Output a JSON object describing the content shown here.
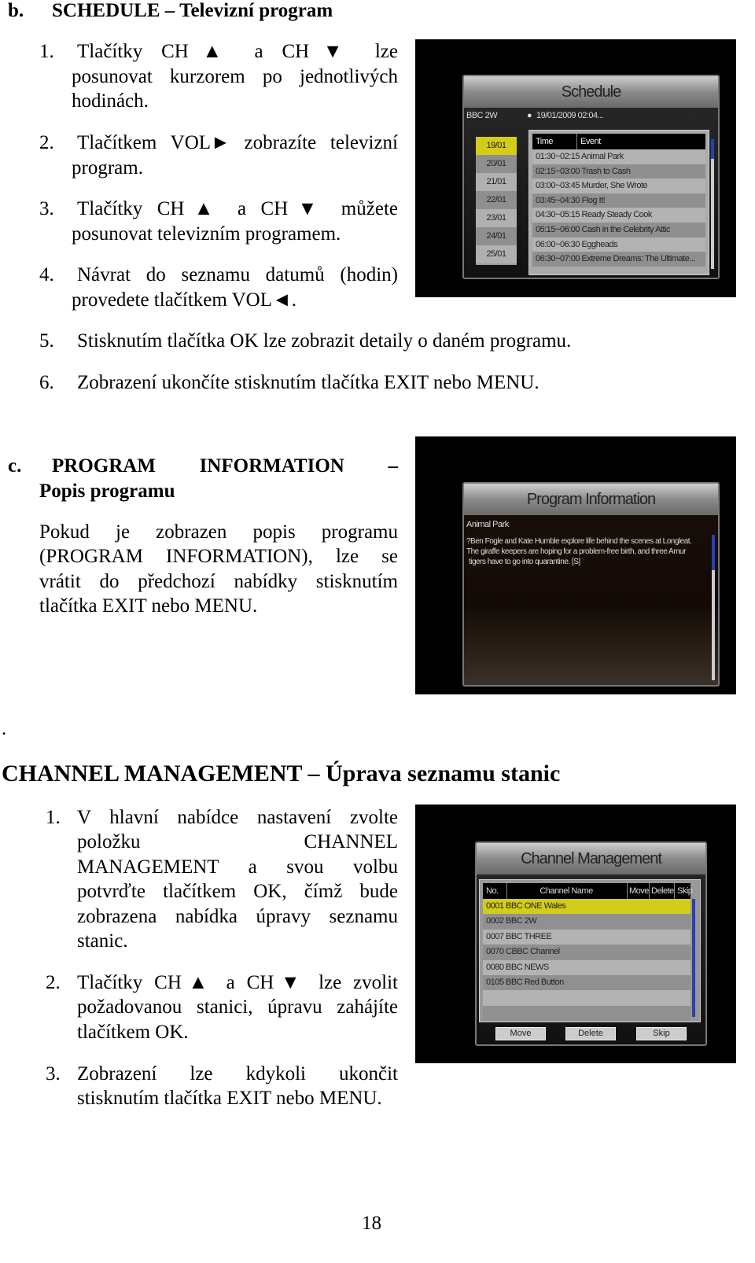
{
  "section_b": {
    "letter": "b.",
    "title": "SCHEDULE – Televizní program",
    "items": [
      {
        "num": "1.",
        "text_first": "Tlačítky CH▲ a CH▼ lze",
        "text_rest": [
          "posunovat kurzorem po jednotlivých",
          "hodinách."
        ]
      },
      {
        "num": "2.",
        "text_first": "Tlačítkem VOL► zobrazíte televizní",
        "text_rest": [
          "program."
        ]
      },
      {
        "num": "3.",
        "text_first": "Tlačítky CH▲ a CH▼ můžete",
        "text_rest": [
          "posunovat televizním programem."
        ]
      },
      {
        "num": "4.",
        "text_first": "Návrat do seznamu datumů (hodin)",
        "text_rest": [
          "provedete tlačítkem VOL◄."
        ]
      },
      {
        "num": "5.",
        "text_first": "Stisknutím tlačítka OK lze zobrazit detaily o daném programu.",
        "text_rest": []
      },
      {
        "num": "6.",
        "text_first": "Zobrazení ukončíte stisknutím tlačítka EXIT nebo MENU.",
        "text_rest": []
      }
    ],
    "screen": {
      "title": "Schedule",
      "channel": "BBC 2W",
      "datetime": "19/01/2009 02:04...",
      "dates": [
        "19/01",
        "20/01",
        "21/01",
        "22/01",
        "23/01",
        "24/01",
        "25/01"
      ],
      "columns": [
        "Time",
        "Event"
      ],
      "events": [
        "01:30~02:15 Animal Park",
        "02:15~03:00 Trash to Cash",
        "03:00~03:45 Murder, She Wrote",
        "03:45~04:30 Flog It!",
        "04:30~05:15 Ready Steady Cook",
        "05:15~06:00 Cash in the Celebrity Attic",
        "06:00~06:30 Eggheads",
        "06:30~07:00 Extreme Dreams: The Ultimate..."
      ]
    }
  },
  "section_c": {
    "letter": "c.",
    "title_line1": "PROGRAM INFORMATION –",
    "title_line2": "Popis programu",
    "paragraph": [
      "Pokud je zobrazen popis programu",
      "(PROGRAM INFORMATION), lze se",
      "vrátit do předchozí nabídky stisknutím",
      "tlačítka EXIT nebo MENU."
    ],
    "screen": {
      "title": "Program Information",
      "program": "Animal Park",
      "description": [
        "?Ben Fogle and Kate Humble explore life behind the scenes at Longleat.",
        "The giraffe keepers are hoping for a problem-free birth, and three Amur",
        "tigers have to go into quarantine. [S]"
      ]
    }
  },
  "stray_dot": ".",
  "section_cm": {
    "title": "CHANNEL MANAGEMENT – Úprava seznamu stanic",
    "items": [
      {
        "num": "1.",
        "lines": [
          "V hlavní nabídce nastavení zvolte",
          "položku CHANNEL",
          "MANAGEMENT a svou volbu",
          "potvrďte tlačítkem OK, čímž bude",
          "zobrazena nabídka úpravy seznamu",
          "stanic."
        ]
      },
      {
        "num": "2.",
        "lines": [
          "Tlačítky CH▲ a CH▼ lze zvolit",
          "požadovanou stanici, úpravu zahájíte",
          "tlačítkem OK."
        ]
      },
      {
        "num": "3.",
        "lines": [
          "Zobrazení lze kdykoli ukončit",
          "stisknutím tlačítka EXIT nebo MENU."
        ]
      }
    ],
    "screen": {
      "title": "Channel Management",
      "columns": [
        "No.",
        "Channel Name",
        "Move",
        "Delete",
        "Skip"
      ],
      "channels": [
        "0001 BBC ONE Wales",
        "0002 BBC 2W",
        "0007 BBC THREE",
        "0070 CBBC Channel",
        "0080 BBC NEWS",
        "0105 BBC Red Button"
      ],
      "buttons": [
        "Move",
        "Delete",
        "Skip"
      ]
    }
  },
  "page_number": "18",
  "colors": {
    "highlight": "#d4cc1a",
    "scroll_thumb": "#2a3fb0"
  }
}
